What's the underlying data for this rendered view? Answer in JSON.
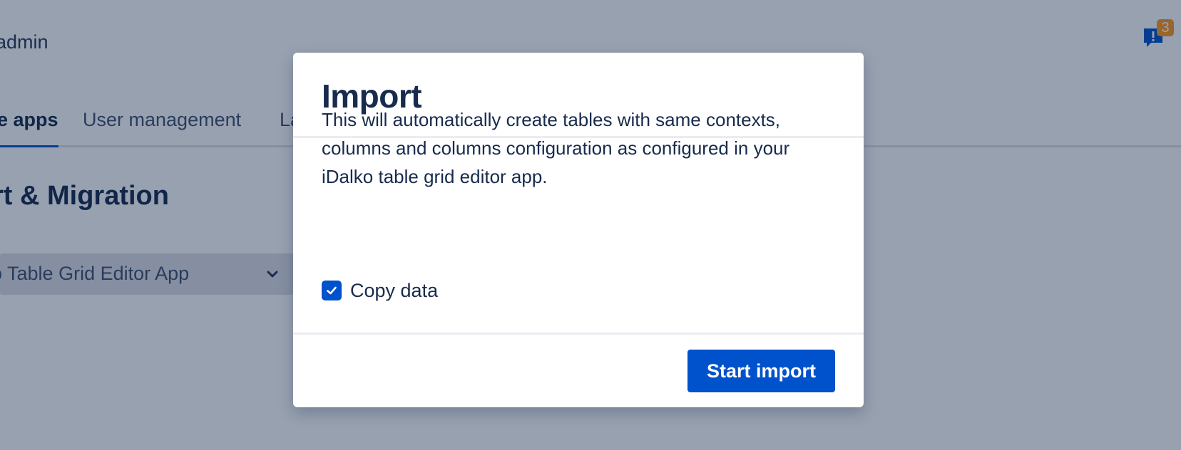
{
  "background": {
    "user_label": "admin",
    "notification_count": "3",
    "tabs": [
      {
        "label": "e apps",
        "active": true
      },
      {
        "label": "User management",
        "active": false
      },
      {
        "label": "La",
        "active": false
      }
    ],
    "heading": "rt & Migration",
    "select_value": "o Table Grid Editor App"
  },
  "dialog": {
    "title": "Import",
    "description": "This will automatically create tables with same contexts, columns and columns configuration as configured in your iDalko table grid editor app.",
    "copy_data_label": "Copy data",
    "copy_data_checked": true,
    "start_import_label": "Start import"
  },
  "colors": {
    "primary": "#0052cc",
    "text": "#172b4d",
    "blanket": "rgba(9, 30, 66, 0.42)",
    "badge": "#ff991f"
  },
  "icons": {
    "notification": "notification-icon",
    "chevron": "chevron-down-icon",
    "check": "check-icon"
  }
}
